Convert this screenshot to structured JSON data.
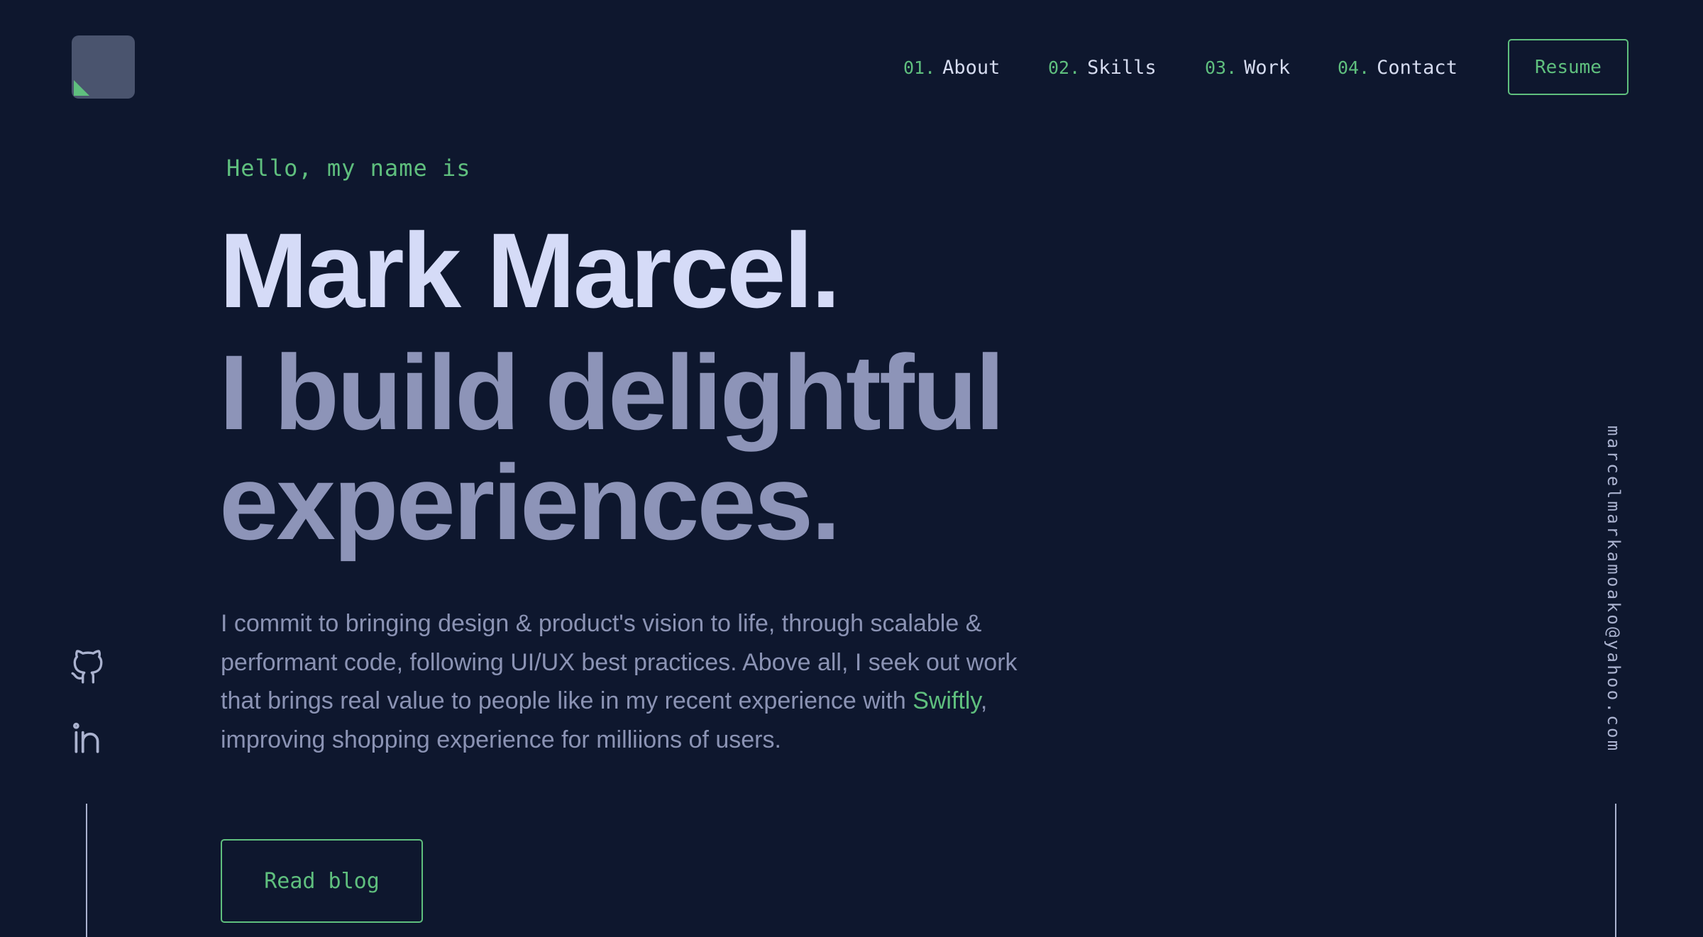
{
  "nav": {
    "items": [
      {
        "number": "01.",
        "label": "About"
      },
      {
        "number": "02.",
        "label": "Skills"
      },
      {
        "number": "03.",
        "label": "Work"
      },
      {
        "number": "04.",
        "label": "Contact"
      }
    ],
    "resume_label": "Resume"
  },
  "hero": {
    "greeting": "Hello, my name is",
    "name": "Mark Marcel.",
    "tagline": "I build delightful experiences.",
    "intro_before": "I commit to bringing design & product's vision to life, through scalable & performant code, following UI/UX best practices. Above all, I seek out work that brings real value to people like in my recent experience with ",
    "intro_link": "Swiftly",
    "intro_after": ", improving shopping experience for milliions of users.",
    "blog_label": "Read blog"
  },
  "social": {
    "icons": [
      "github-icon",
      "linkedin-icon"
    ]
  },
  "email": "marcelmarkamoako@yahoo.com",
  "colors": {
    "background": "#0e172e",
    "accent": "#5fbf7e",
    "heading": "#d5dbf7",
    "subheading": "#8d94b8",
    "body_text": "#8b93b4",
    "logo_tile": "#4a546e"
  }
}
